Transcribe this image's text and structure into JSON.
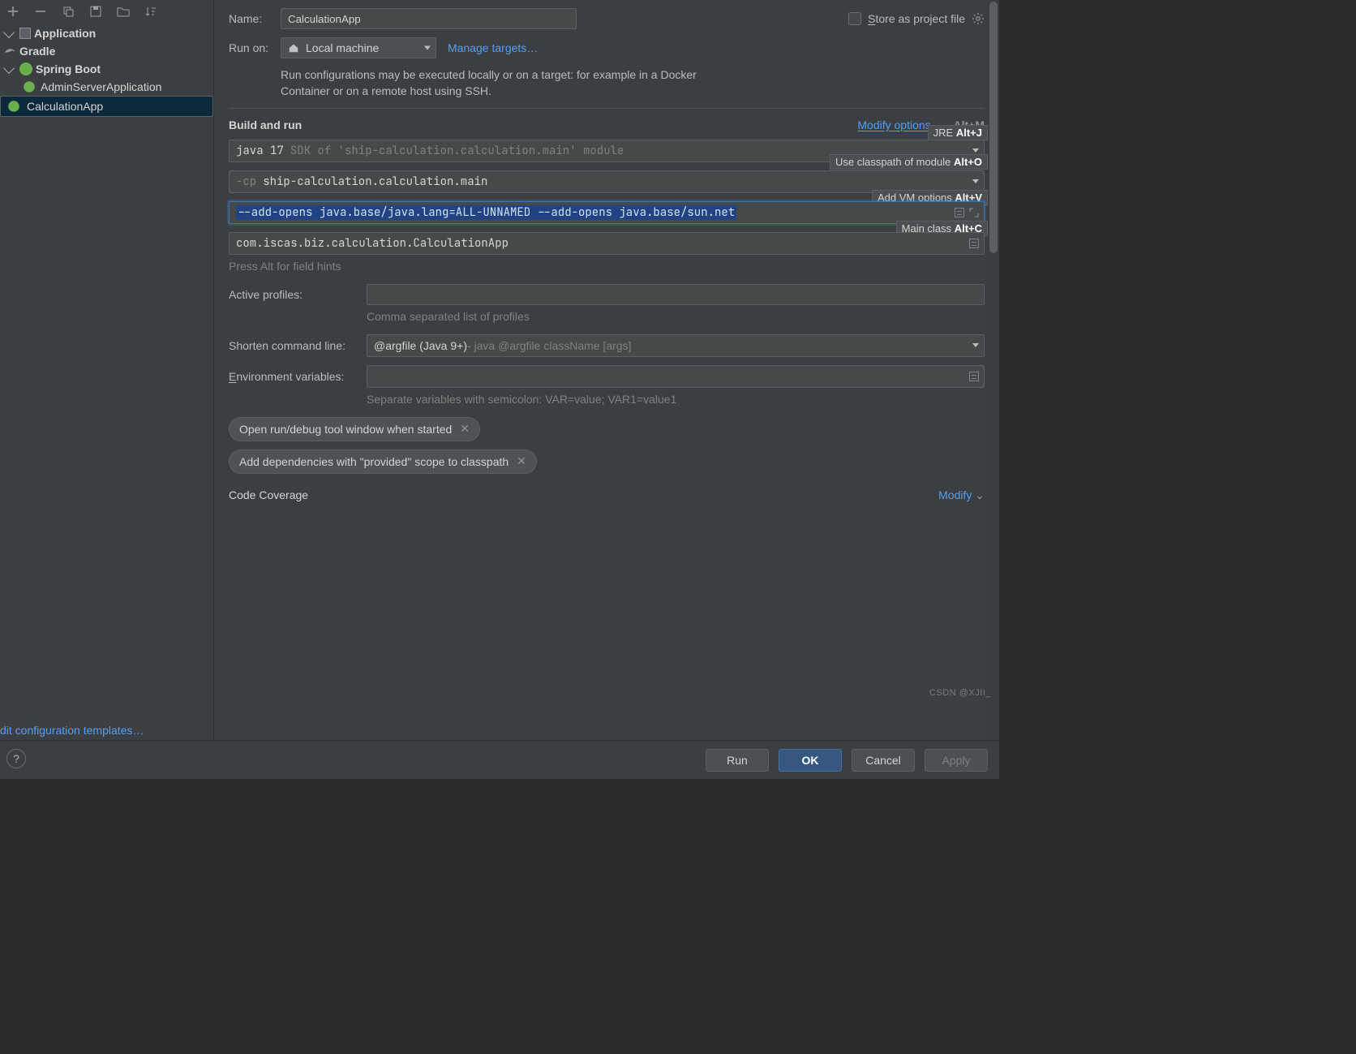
{
  "toolbar": {
    "icons": [
      "plus",
      "minus",
      "copy",
      "save",
      "folder-arrow",
      "sort"
    ]
  },
  "tree": {
    "items": [
      {
        "label": "Application",
        "type": "root",
        "icon": "app"
      },
      {
        "label": "Gradle",
        "type": "root",
        "icon": "gradle"
      },
      {
        "label": "Spring Boot",
        "type": "root",
        "icon": "spring",
        "expanded": true
      },
      {
        "label": "AdminServerApplication",
        "type": "leaf"
      },
      {
        "label": "CalculationApp",
        "type": "leaf",
        "selected": true
      }
    ],
    "edit_templates": "dit configuration templates…"
  },
  "name": {
    "label": "Name:",
    "value": "CalculationApp"
  },
  "store": {
    "label": "Store as project file"
  },
  "runon": {
    "label": "Run on:",
    "value": "Local machine",
    "manage": "Manage targets…",
    "desc": "Run configurations may be executed locally or on a target: for example in a Docker Container or on a remote host using SSH."
  },
  "buildrun": {
    "title": "Build and run",
    "modify": "Modify options",
    "shortcut": "Alt+M",
    "jdk": {
      "prefix": "java 17",
      "suffix": "SDK of 'ship-calculation.calculation.main' module"
    },
    "cp": {
      "prefix": "-cp",
      "value": "ship-calculation.calculation.main"
    },
    "vm": "--add-opens java.base/java.lang=ALL-UNNAMED --add-opens java.base/sun.net",
    "mainclass": "com.iscas.biz.calculation.CalculationApp",
    "hint": "Press Alt for field hints",
    "tips": {
      "jre": {
        "t": "JRE",
        "k": "Alt+J"
      },
      "cp": {
        "t": "Use classpath of module",
        "k": "Alt+O"
      },
      "vm": {
        "t": "Add VM options",
        "k": "Alt+V"
      },
      "mc": {
        "t": "Main class",
        "k": "Alt+C"
      }
    }
  },
  "profiles": {
    "label": "Active profiles:",
    "hint": "Comma separated list of profiles"
  },
  "shorten": {
    "label": "Shorten command line:",
    "value": "@argfile (Java 9+)",
    "suffix": " - java @argfile className [args]"
  },
  "env": {
    "label": "Environment variables:",
    "hint": "Separate variables with semicolon: VAR=value; VAR1=value1"
  },
  "pills": {
    "a": "Open run/debug tool window when started",
    "b": "Add dependencies with \"provided\" scope to classpath"
  },
  "coverage": {
    "title": "Code Coverage",
    "modify": "Modify"
  },
  "footer": {
    "run": "Run",
    "ok": "OK",
    "cancel": "Cancel",
    "apply": "Apply"
  },
  "watermark": "CSDN @XJII_"
}
